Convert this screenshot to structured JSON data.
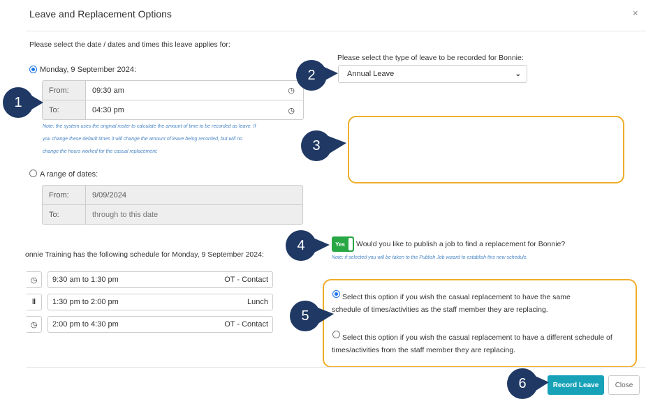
{
  "dialog": {
    "title": "Leave and Replacement Options",
    "close": "×"
  },
  "dates": {
    "prompt": "Please select the date / dates and times this leave applies for:",
    "single_label": "Monday, 9 September 2024:",
    "from_label": "From:",
    "from_value": "09:30 am",
    "to_label": "To:",
    "to_value": "04:30 pm",
    "note_line1": "Note: the system uses the original roster to calculate the amount of time to be recorded as leave. If",
    "note_line2": "you change these default times it will change the amount of leave being recorded, but will no",
    "note_line3": "change the hours worked for the casual replacement.",
    "range_label": "A range of dates:",
    "range_from_label": "From:",
    "range_from_value": "9/09/2024",
    "range_to_label": "To:",
    "range_to_placeholder": "through to this date"
  },
  "leave_type": {
    "prompt": "Please select the type of leave to be recorded for Bonnie:",
    "selected": "Annual Leave"
  },
  "schedule": {
    "heading": "onnie Training has the following schedule for Monday, 9 September 2024:",
    "rows": [
      {
        "icon": "clock-icon",
        "glyph": "◷",
        "time": "9:30 am to 1:30 pm",
        "activity": "OT - Contact"
      },
      {
        "icon": "utensils-icon",
        "glyph": "🍴",
        "time": "1:30 pm to 2:00 pm",
        "activity": "Lunch"
      },
      {
        "icon": "clock-icon",
        "glyph": "◷",
        "time": "2:00 pm to 4:30 pm",
        "activity": "OT - Contact"
      }
    ]
  },
  "publish": {
    "toggle_label": "Yes",
    "question": "Would you like to publish a job to find a replacement for Bonnie?",
    "note": "Note: if selected you will be taken to the Publish Job wizard to establish this new schedule."
  },
  "replacement": {
    "same_line1": "Select this option if you wish the casual replacement to have the same",
    "same_line2": "schedule of times/activities as the staff member they are replacing.",
    "different_line1": "Select this option if you wish the casual replacement to have a different schedule of",
    "different_line2": "times/activities from the staff member they are replacing."
  },
  "footer": {
    "record_label": "Record Leave",
    "close_label": "Close"
  },
  "callouts": [
    "1",
    "2",
    "3",
    "4",
    "5",
    "6"
  ],
  "colors": {
    "callout": "#1f3864",
    "highlight": "#f0ad2a",
    "primary": "#17a2b8",
    "toggle": "#28a745",
    "radio": "#1a73e8"
  }
}
